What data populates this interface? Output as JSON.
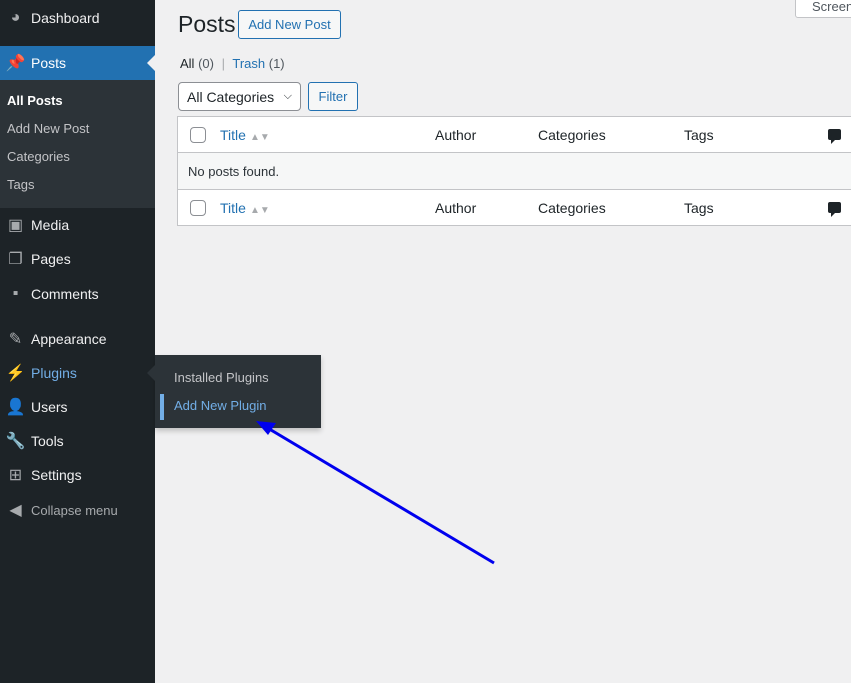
{
  "sidebar": {
    "items": [
      {
        "label": "Dashboard",
        "icon": "dashboard-icon"
      },
      {
        "label": "Posts",
        "icon": "pin-icon",
        "active": true
      },
      {
        "label": "Media",
        "icon": "media-icon"
      },
      {
        "label": "Pages",
        "icon": "pages-icon"
      },
      {
        "label": "Comments",
        "icon": "comment-icon"
      },
      {
        "label": "Appearance",
        "icon": "paintbrush-icon"
      },
      {
        "label": "Plugins",
        "icon": "plugin-icon"
      },
      {
        "label": "Users",
        "icon": "user-icon"
      },
      {
        "label": "Tools",
        "icon": "wrench-icon"
      },
      {
        "label": "Settings",
        "icon": "settings-icon"
      },
      {
        "label": "Collapse menu",
        "icon": "collapse-icon"
      }
    ],
    "posts_submenu": [
      "All Posts",
      "Add New Post",
      "Categories",
      "Tags"
    ],
    "plugins_flyout": [
      "Installed Plugins",
      "Add New Plugin"
    ]
  },
  "header": {
    "title": "Posts",
    "add_new": "Add New Post",
    "screen_options": "Screen"
  },
  "filters": {
    "all": "All",
    "all_count": "(0)",
    "sep": "|",
    "trash": "Trash",
    "trash_count": "(1)",
    "category": "All Categories",
    "filter_button": "Filter"
  },
  "table": {
    "columns": [
      "Title",
      "Author",
      "Categories",
      "Tags"
    ],
    "empty": "No posts found."
  },
  "colors": {
    "accent": "#2271b1",
    "sidebar": "#1d2327",
    "arrow": "#0000ee"
  }
}
